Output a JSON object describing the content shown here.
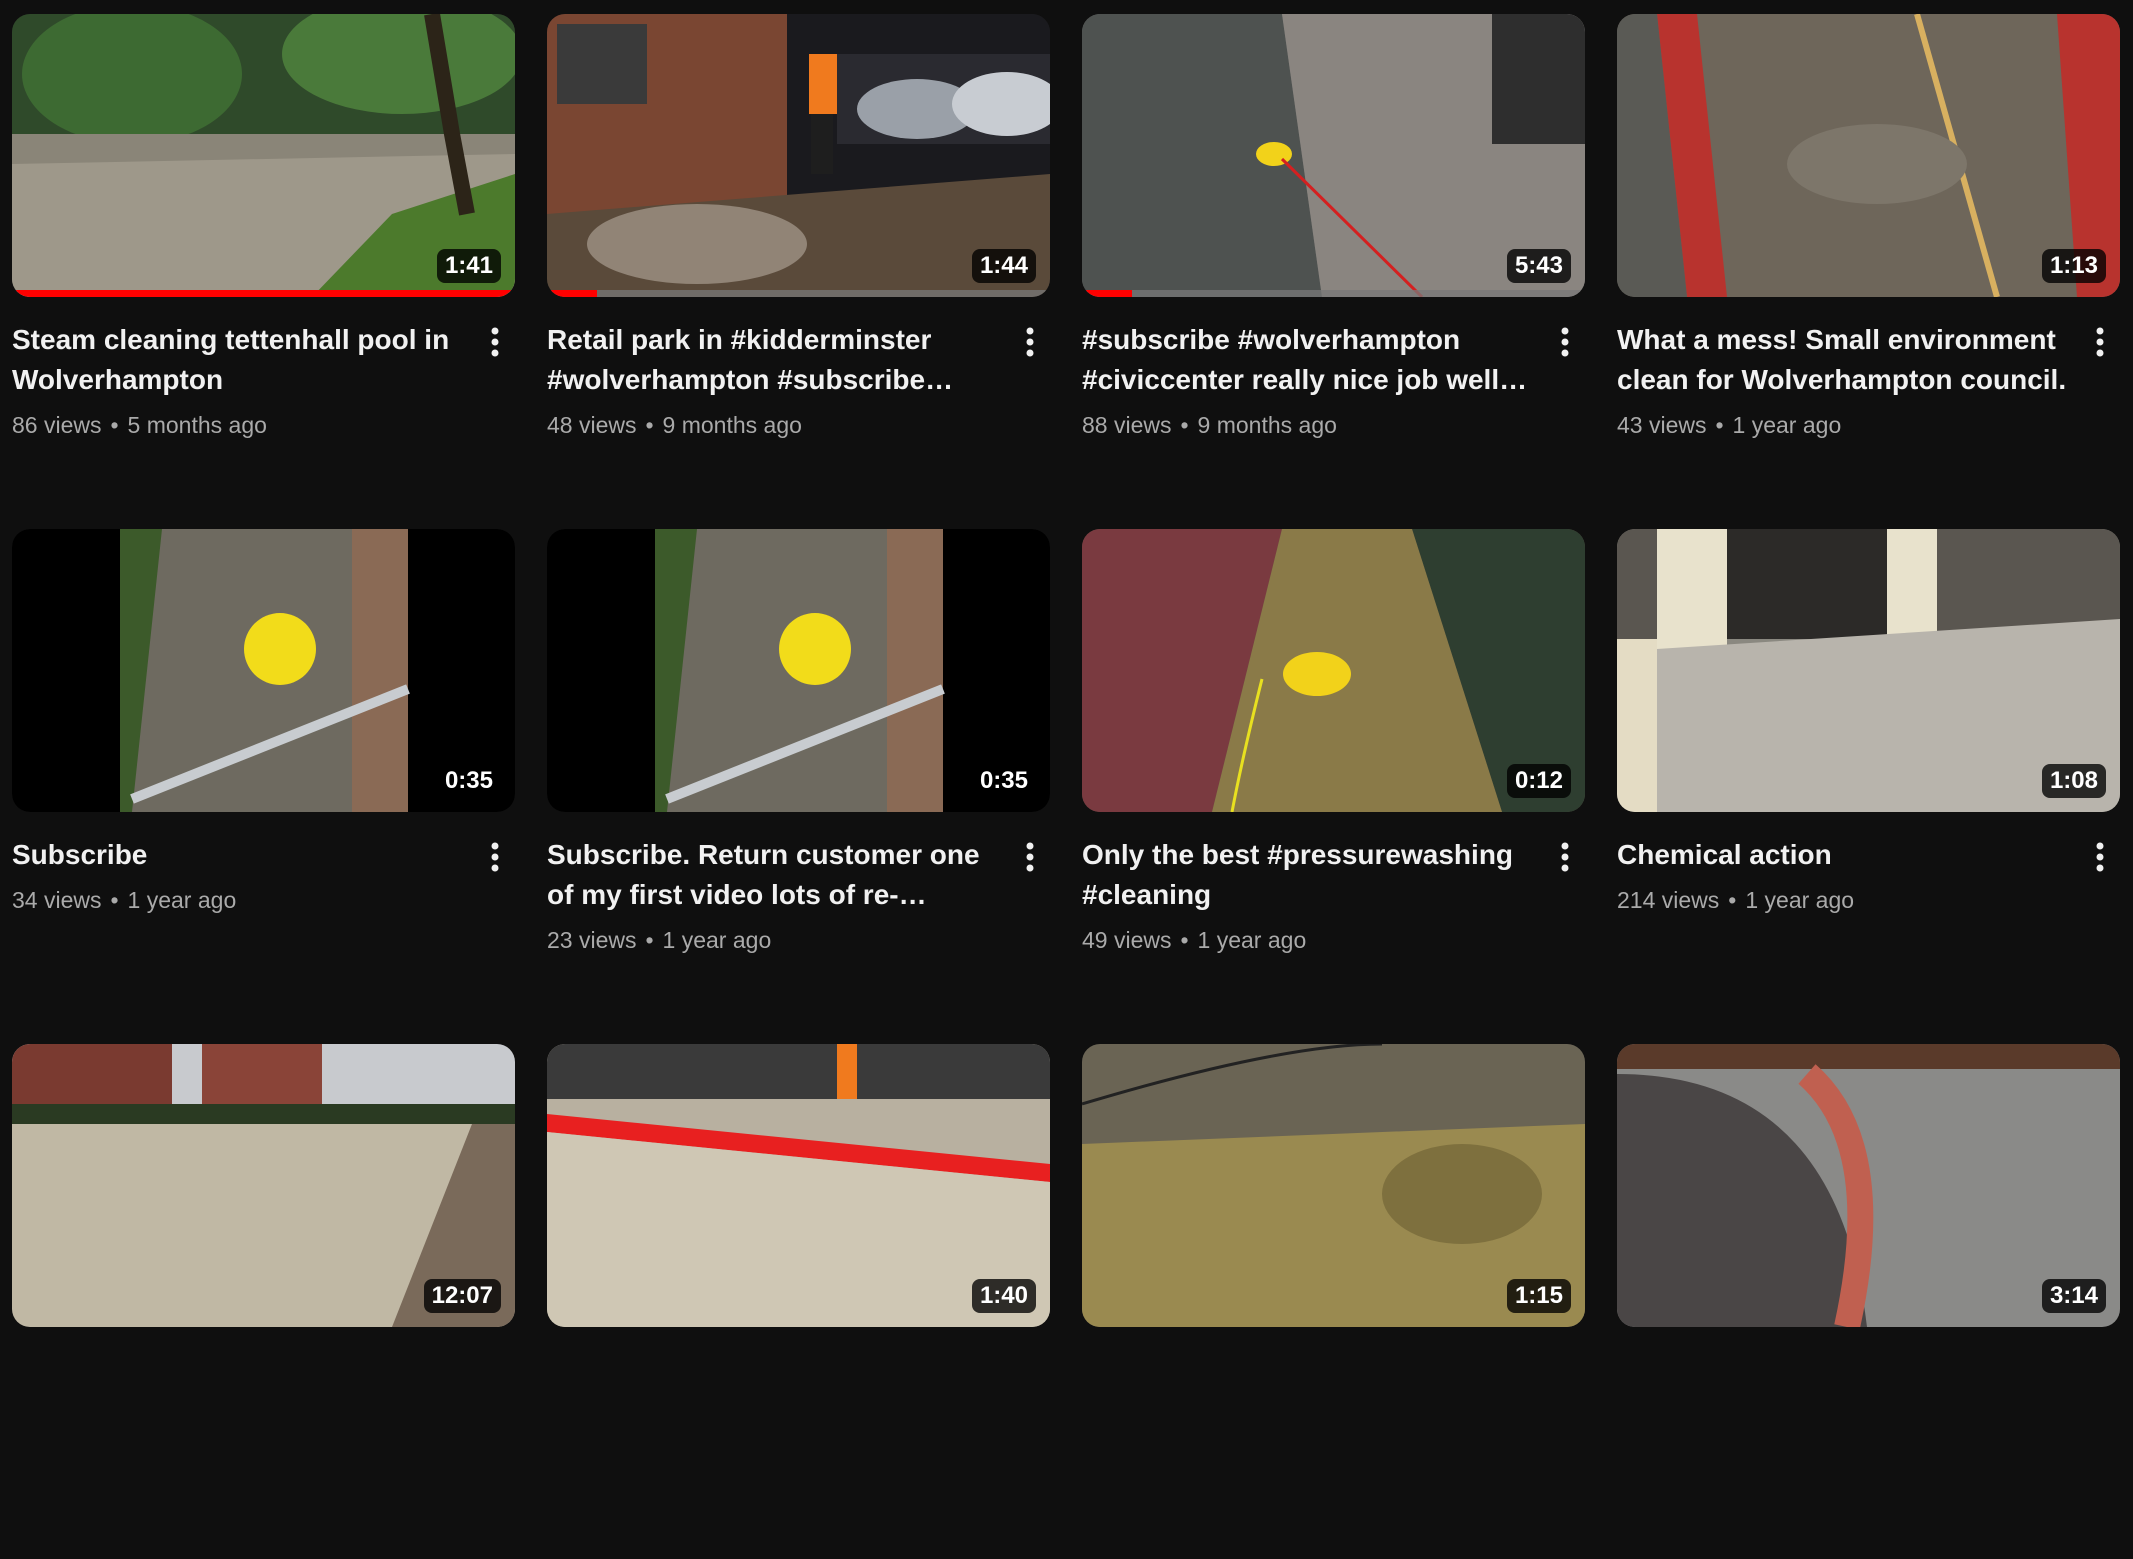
{
  "videos": [
    {
      "title": "Steam cleaning tettenhall pool in Wolverhampton",
      "views": "86 views",
      "age": "5 months ago",
      "duration": "1:41",
      "watched": 1.0
    },
    {
      "title": "Retail park in #kidderminster #wolverhampton #subscribe #wolverhampton #subscribe",
      "views": "48 views",
      "age": "9 months ago",
      "duration": "1:44",
      "watched": 0.1
    },
    {
      "title": "#subscribe #wolverhampton #civiccenter really nice job well done",
      "views": "88 views",
      "age": "9 months ago",
      "duration": "5:43",
      "watched": 0.1
    },
    {
      "title": "What a mess! Small environment clean for Wolverhampton council.",
      "views": "43 views",
      "age": "1 year ago",
      "duration": "1:13",
      "watched": 0
    },
    {
      "title": "Subscribe",
      "views": "34 views",
      "age": "1 year ago",
      "duration": "0:35",
      "watched": 0
    },
    {
      "title": "Subscribe. Return customer one of my first video lots of re-pointing and cleaning",
      "views": "23 views",
      "age": "1 year ago",
      "duration": "0:35",
      "watched": 0
    },
    {
      "title": "Only the best #pressurewashing #cleaning",
      "views": "49 views",
      "age": "1 year ago",
      "duration": "0:12",
      "watched": 0
    },
    {
      "title": "Chemical action",
      "views": "214 views",
      "age": "1 year ago",
      "duration": "1:08",
      "watched": 0
    },
    {
      "title": "",
      "views": "",
      "age": "",
      "duration": "12:07",
      "watched": 0
    },
    {
      "title": "",
      "views": "",
      "age": "",
      "duration": "1:40",
      "watched": 0
    },
    {
      "title": "",
      "views": "",
      "age": "",
      "duration": "1:15",
      "watched": 0
    },
    {
      "title": "",
      "views": "",
      "age": "",
      "duration": "3:14",
      "watched": 0
    }
  ],
  "colors": {
    "background": "#0f0f0f",
    "title": "#f1f1f1",
    "meta": "#aaaaaa",
    "progress": "#ff0000"
  },
  "icons": {
    "more": "more-vertical-icon"
  }
}
